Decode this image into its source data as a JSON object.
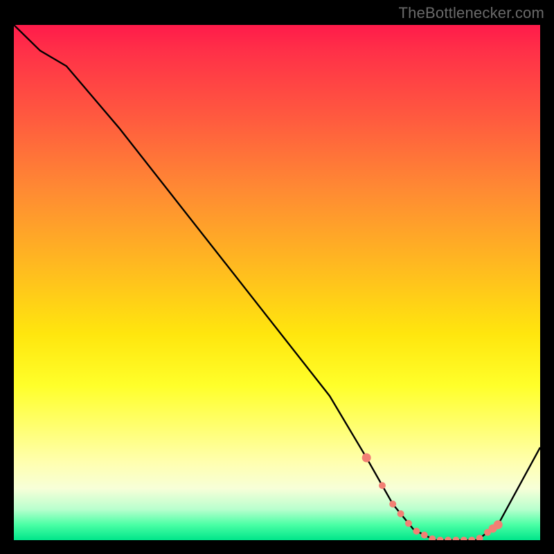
{
  "attribution": "TheBottlenecker.com",
  "chart_data": {
    "type": "line",
    "title": "",
    "xlabel": "",
    "ylabel": "",
    "xlim": [
      0,
      100
    ],
    "ylim": [
      0,
      100
    ],
    "x": [
      0,
      5,
      10,
      20,
      30,
      40,
      50,
      60,
      67,
      72,
      76,
      80,
      84,
      88,
      92,
      100
    ],
    "values": [
      100,
      95,
      92,
      80,
      67,
      54,
      41,
      28,
      16,
      7,
      2,
      0,
      0,
      0,
      3,
      18
    ],
    "marker_points_x": [
      67,
      70,
      72,
      73.5,
      75,
      76.5,
      78,
      79.5,
      81,
      82.5,
      84,
      85.5,
      87,
      88.5,
      90,
      91,
      92
    ],
    "marker_style": "dot",
    "colors": {
      "line": "#000000",
      "markers": "#f28074",
      "gradient_top": "#ff1b4a",
      "gradient_bottom": "#00e58a"
    }
  }
}
